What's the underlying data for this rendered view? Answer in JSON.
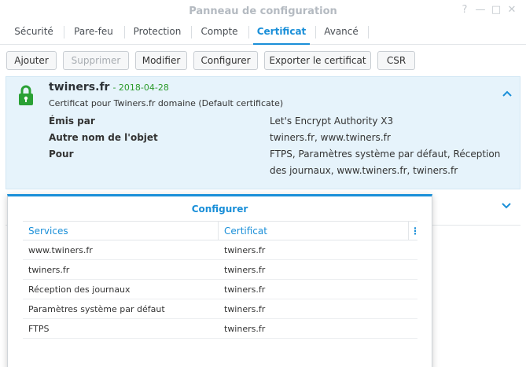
{
  "window": {
    "title": "Panneau de configuration",
    "controls": [
      "?",
      "—",
      "□",
      "✕"
    ]
  },
  "tabs": [
    {
      "label": "Sécurité"
    },
    {
      "label": "Pare-feu"
    },
    {
      "label": "Protection"
    },
    {
      "label": "Compte"
    },
    {
      "label": "Certificat",
      "active": true
    },
    {
      "label": "Avancé"
    }
  ],
  "toolbar": {
    "add": "Ajouter",
    "delete": "Supprimer",
    "edit": "Modifier",
    "configure": "Configurer",
    "export": "Exporter le certificat",
    "csr": "CSR"
  },
  "certificate": {
    "name": "twiners.fr",
    "date": "- 2018-04-28",
    "description": "Certificat pour Twiners.fr domaine (Default certificate)",
    "issued_by_label": "Émis par",
    "issued_by_value": "Let's Encrypt Authority X3",
    "alt_name_label": "Autre nom de l'objet",
    "alt_name_value": "twiners.fr, www.twiners.fr",
    "for_label": "Pour",
    "for_value": "FTPS, Paramètres système par défaut, Réception des journaux, www.twiners.fr, twiners.fr"
  },
  "dialog": {
    "title": "Configurer",
    "headers": {
      "services": "Services",
      "certificate": "Certificat",
      "menu": "⋮"
    },
    "rows": [
      {
        "service": "www.twiners.fr",
        "cert": "twiners.fr"
      },
      {
        "service": "twiners.fr",
        "cert": "twiners.fr"
      },
      {
        "service": "Réception des journaux",
        "cert": "twiners.fr"
      },
      {
        "service": "Paramètres système par défaut",
        "cert": "twiners.fr"
      },
      {
        "service": "FTPS",
        "cert": "twiners.fr"
      }
    ]
  },
  "colors": {
    "accent": "#1a8fd8",
    "lock_green": "#2aa135",
    "date_green": "#2b9a2b",
    "selected_bg": "#e6f3fb"
  },
  "icons": {
    "lock": "lock-icon",
    "collapse": "chevron-up-icon",
    "expand": "chevron-down-icon",
    "column_menu": "more-vertical-icon"
  }
}
